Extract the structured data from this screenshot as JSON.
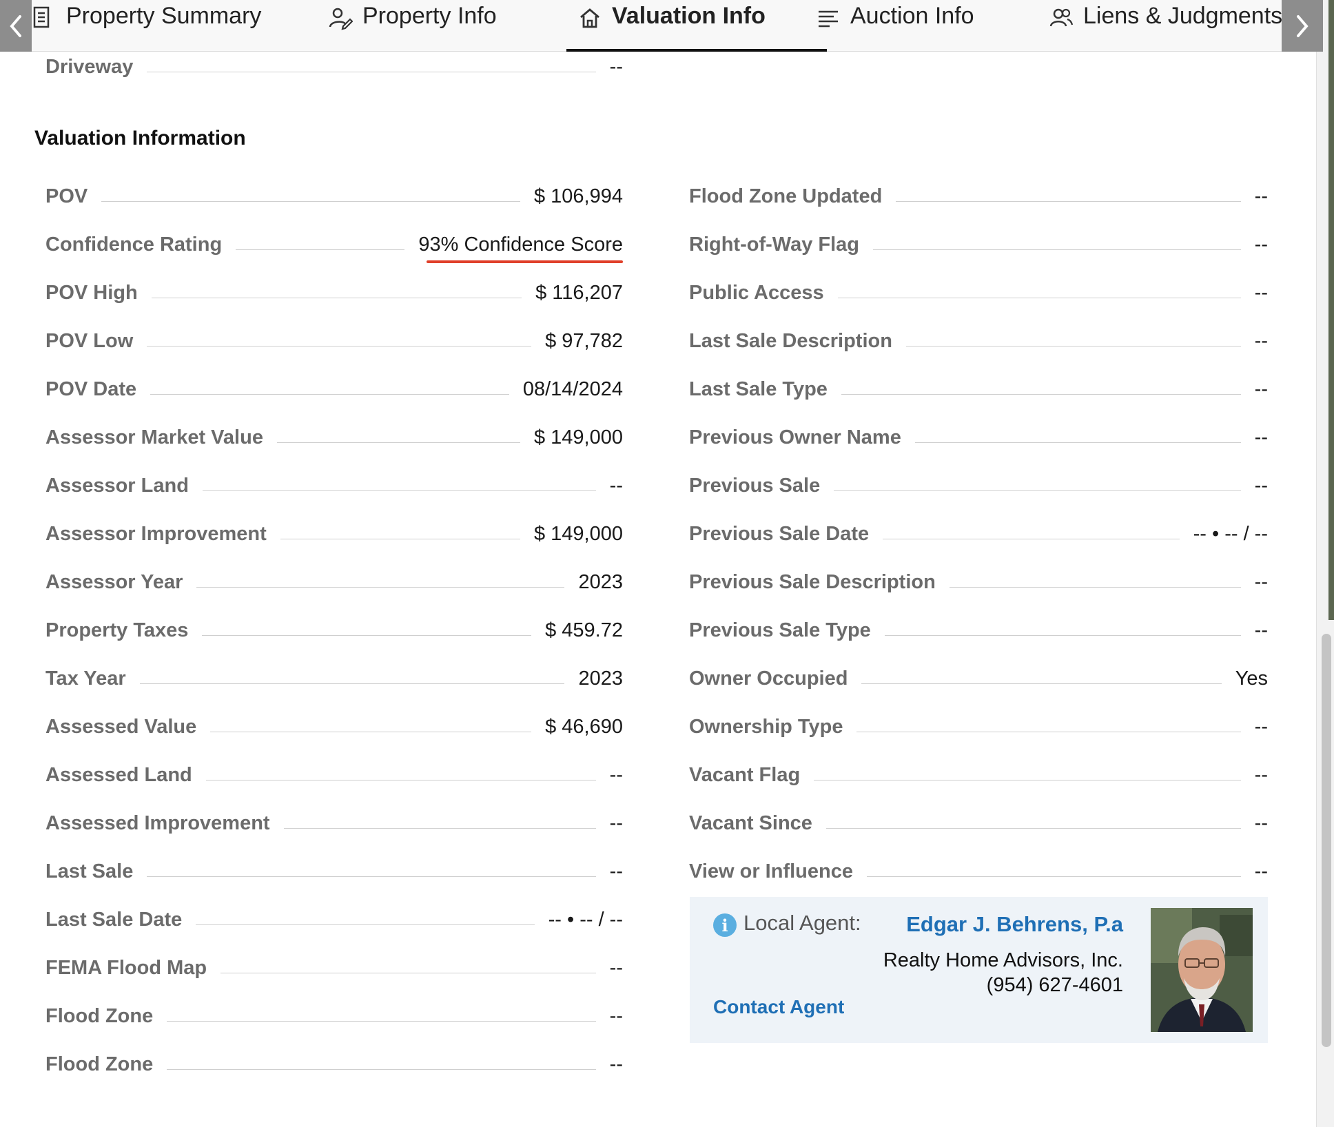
{
  "tabs": [
    {
      "label": "Property Summary",
      "icon": "document-icon",
      "active": false
    },
    {
      "label": "Property Info",
      "icon": "user-edit-icon",
      "active": false
    },
    {
      "label": "Valuation Info",
      "icon": "home-icon",
      "active": true
    },
    {
      "label": "Auction Info",
      "icon": "list-icon",
      "active": false
    },
    {
      "label": "Liens & Judgments",
      "icon": "users-icon",
      "active": false
    }
  ],
  "partial_row": {
    "label": "Driveway",
    "value": "--"
  },
  "section_title": "Valuation Information",
  "left_rows": [
    {
      "label": "POV",
      "value": "$ 106,994"
    },
    {
      "label": "Confidence Rating",
      "value": "93% Confidence Score"
    },
    {
      "label": "POV High",
      "value": "$ 116,207"
    },
    {
      "label": "POV Low",
      "value": "$ 97,782"
    },
    {
      "label": "POV Date",
      "value": "08/14/2024"
    },
    {
      "label": "Assessor Market Value",
      "value": "$ 149,000"
    },
    {
      "label": "Assessor Land",
      "value": "--"
    },
    {
      "label": "Assessor Improvement",
      "value": "$ 149,000"
    },
    {
      "label": "Assessor Year",
      "value": "2023"
    },
    {
      "label": "Property Taxes",
      "value": "$ 459.72"
    },
    {
      "label": "Tax Year",
      "value": "2023"
    },
    {
      "label": "Assessed Value",
      "value": "$ 46,690"
    },
    {
      "label": "Assessed Land",
      "value": "--"
    },
    {
      "label": "Assessed Improvement",
      "value": "--"
    },
    {
      "label": "Last Sale",
      "value": "--"
    },
    {
      "label": "Last Sale Date",
      "value": "-- • -- / --"
    },
    {
      "label": "FEMA Flood Map",
      "value": "--"
    },
    {
      "label": "Flood Zone",
      "value": "--"
    },
    {
      "label": "Flood Zone",
      "value": "--"
    }
  ],
  "right_rows": [
    {
      "label": "Flood Zone Updated",
      "value": "--"
    },
    {
      "label": "Right-of-Way Flag",
      "value": "--"
    },
    {
      "label": "Public Access",
      "value": "--"
    },
    {
      "label": "Last Sale Description",
      "value": "--"
    },
    {
      "label": "Last Sale Type",
      "value": "--"
    },
    {
      "label": "Previous Owner Name",
      "value": "--"
    },
    {
      "label": "Previous Sale",
      "value": "--"
    },
    {
      "label": "Previous Sale Date",
      "value": "-- • -- / --"
    },
    {
      "label": "Previous Sale Description",
      "value": "--"
    },
    {
      "label": "Previous Sale Type",
      "value": "--"
    },
    {
      "label": "Owner Occupied",
      "value": "Yes"
    },
    {
      "label": "Ownership Type",
      "value": "--"
    },
    {
      "label": "Vacant Flag",
      "value": "--"
    },
    {
      "label": "Vacant Since",
      "value": "--"
    },
    {
      "label": "View or Influence",
      "value": "--"
    }
  ],
  "agent": {
    "label": "Local Agent:",
    "name": "Edgar J. Behrens, P.a",
    "company": "Realty Home Advisors, Inc.",
    "phone": "(954) 627-4601",
    "contact_label": "Contact Agent"
  },
  "colors": {
    "accent_link": "#1f6fb5",
    "confidence_underline": "#e0402a",
    "card_bg": "#eef3f8"
  }
}
